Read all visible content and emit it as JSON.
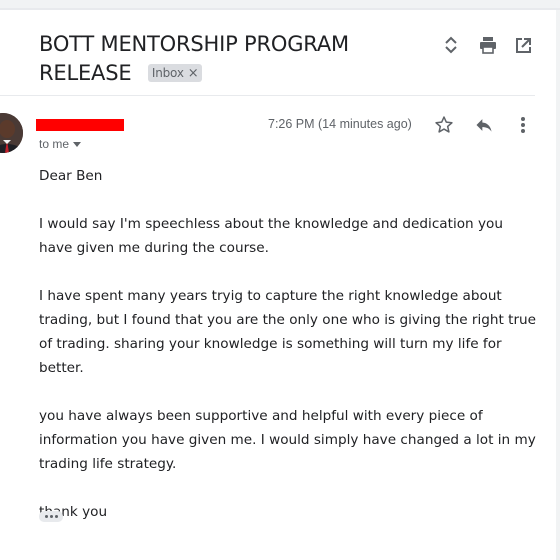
{
  "header": {
    "subject_line1": "BOTT MENTORSHIP PROGRAM",
    "subject_line2": "RELEASE",
    "label_chip": "Inbox",
    "label_remove": "×",
    "actions": [
      "expand-collapse-icon",
      "print-icon",
      "open-new-window-icon"
    ]
  },
  "message": {
    "sender_redacted": true,
    "recipient": "to me",
    "time": "7:26 PM (14 minutes ago)",
    "actions": [
      "star-icon",
      "reply-icon",
      "more-vert-icon"
    ],
    "greeting": "Dear Ben",
    "paragraphs": [
      "I would say I'm speechless about the knowledge and dedication you have given me during the course.",
      "I have spent many years tryig to capture the right knowledge about trading, but I found that you are the only one who is giving the right true of trading. sharing your knowledge is something will turn my life for better.",
      "you have always been supportive and helpful with every piece of information you have given me. I would simply have changed a lot in my trading life strategy."
    ],
    "closing": "thank you"
  },
  "colors": {
    "text": "#202124",
    "muted": "#5f6368",
    "chip_bg": "#dadce0",
    "redaction": "#ff0000"
  }
}
